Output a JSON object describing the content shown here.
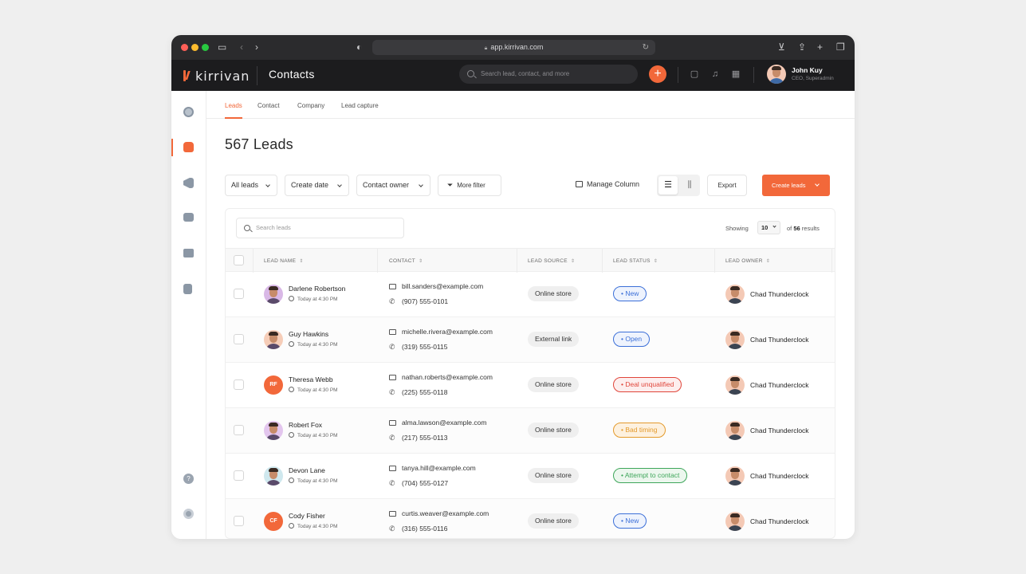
{
  "browser": {
    "url": "app.kirrivan.com"
  },
  "app": {
    "logo_text": "kirrivan",
    "title": "Contacts",
    "search_placeholder": "Search lead, contact, and more",
    "user": {
      "name": "John Kuy",
      "role": "CEO, Superadmin"
    }
  },
  "tabs": [
    "Leads",
    "Contact",
    "Company",
    "Lead capture"
  ],
  "page": {
    "title": "567 Leads"
  },
  "filters": {
    "all_leads": "All leads",
    "create_date": "Create date",
    "contact_owner": "Contact owner",
    "more_filter": "More filter",
    "manage_column": "Manage Column",
    "export": "Export",
    "create_leads": "Create leads"
  },
  "table": {
    "search_placeholder": "Search leads",
    "showing_label": "Showing",
    "page_size": "10",
    "results_prefix": "of",
    "results_count": "56",
    "results_suffix": "results",
    "columns": [
      "LEAD NAME",
      "CONTACT",
      "LEAD SOURCE",
      "LEAD STATUS",
      "LEAD OWNER"
    ],
    "rows": [
      {
        "name": "Darlene Robertson",
        "time": "Today at 4:30 PM",
        "initials": "",
        "avatar_color": "#d9b8e6",
        "email": "bill.sanders@example.com",
        "phone": "(907) 555-0101",
        "source": "Online store",
        "status": "• New",
        "status_kind": "new",
        "owner": "Chad Thunderclock"
      },
      {
        "name": "Guy Hawkins",
        "time": "Today at 4:30 PM",
        "initials": "",
        "avatar_color": "#f6cdb8",
        "email": "michelle.rivera@example.com",
        "phone": "(319) 555-0115",
        "source": "External link",
        "status": "• Open",
        "status_kind": "new",
        "owner": "Chad Thunderclock"
      },
      {
        "name": "Theresa Webb",
        "time": "Today at 4:30 PM",
        "initials": "RF",
        "avatar_color": "#f2683a",
        "email": "nathan.roberts@example.com",
        "phone": "(225) 555-0118",
        "source": "Online store",
        "status": "• Deal unqualified",
        "status_kind": "bad",
        "owner": "Chad Thunderclock"
      },
      {
        "name": "Robert Fox",
        "time": "Today at 4:30 PM",
        "initials": "",
        "avatar_color": "#e3c6ee",
        "email": "alma.lawson@example.com",
        "phone": "(217) 555-0113",
        "source": "Online store",
        "status": "• Bad timing",
        "status_kind": "warn",
        "owner": "Chad Thunderclock"
      },
      {
        "name": "Devon Lane",
        "time": "Today at 4:30 PM",
        "initials": "",
        "avatar_color": "#cfe8ee",
        "email": "tanya.hill@example.com",
        "phone": "(704) 555-0127",
        "source": "Online store",
        "status": "• Attempt to contact",
        "status_kind": "good",
        "owner": "Chad Thunderclock"
      },
      {
        "name": "Cody Fisher",
        "time": "Today at 4:30 PM",
        "initials": "CF",
        "avatar_color": "#f2683a",
        "email": "curtis.weaver@example.com",
        "phone": "(316) 555-0116",
        "source": "Online store",
        "status": "• New",
        "status_kind": "new",
        "owner": "Chad Thunderclock"
      }
    ]
  },
  "colors": {
    "accent": "#f2683a",
    "status_new": "#3b6fd8",
    "status_bad": "#e0453a",
    "status_warn": "#e49a2c",
    "status_good": "#3ea65a"
  },
  "icons": [
    "sidebar-toggle-icon",
    "back-icon",
    "forward-icon",
    "shield-icon",
    "lock-icon",
    "reload-icon",
    "download-icon",
    "share-icon",
    "new-tab-icon",
    "tabs-icon",
    "search-icon",
    "plus-icon",
    "chat-icon",
    "bell-icon",
    "calendar-icon",
    "dashboard-icon",
    "leads-icon",
    "campaign-icon",
    "store-icon",
    "briefcase-icon",
    "report-icon",
    "help-icon",
    "settings-icon",
    "filter-icon",
    "columns-icon",
    "list-view-icon",
    "kanban-view-icon",
    "mail-icon",
    "phone-icon",
    "clock-icon",
    "sort-icon",
    "chevron-down-icon"
  ]
}
